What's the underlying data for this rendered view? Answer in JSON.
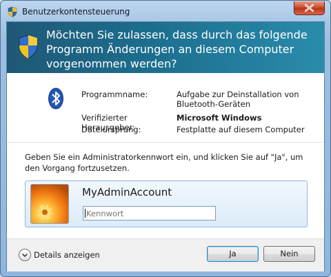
{
  "window": {
    "title": "Benutzerkontensteuerung",
    "close_icon": "close-icon"
  },
  "header": {
    "question": "Möchten Sie zulassen, dass durch das folgende Programm Änderungen an diesem Computer vorgenommen werden?",
    "icon": "uac-shield-icon"
  },
  "program": {
    "icon": "bluetooth-icon",
    "rows": [
      {
        "label": "Programmname:",
        "value": "Aufgabe zur Deinstallation von Bluetooth-Geräten"
      },
      {
        "label": "Verifizierter Herausgeber:",
        "value": "Microsoft Windows"
      },
      {
        "label": "Dateiursprung:",
        "value": "Festplatte auf diesem Computer"
      }
    ]
  },
  "instruction": "Geben Sie ein Administratorkennwort ein, und klicken Sie auf \"Ja\", um den Vorgang fortzusetzen.",
  "credential": {
    "account_name": "MyAdminAccount",
    "password_placeholder": "Kennwort",
    "avatar": "user-avatar-flower"
  },
  "footer": {
    "details_label": "Details anzeigen",
    "yes_label": "Ja",
    "no_label": "Nein"
  },
  "colors": {
    "header_band": "#1c6e8e",
    "frame": "#a9c8e6",
    "close_button": "#c8472a"
  }
}
